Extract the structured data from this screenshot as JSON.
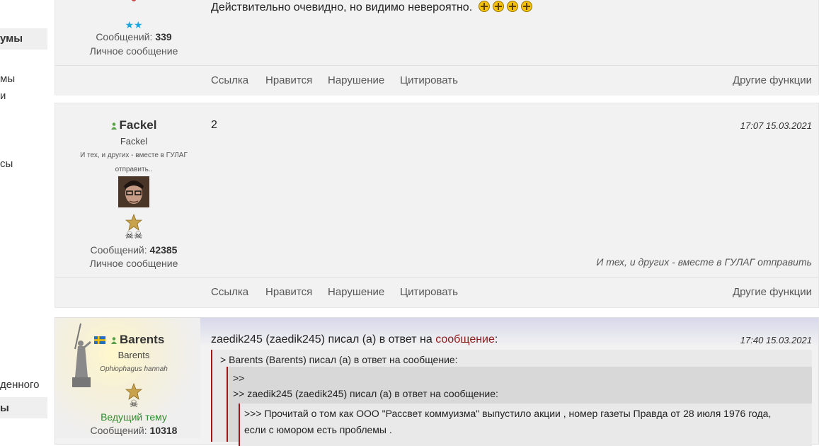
{
  "sidebar": {
    "items": [
      {
        "label": "умы",
        "bold": true
      },
      {
        "label": "мы",
        "bold": false
      },
      {
        "label": "и",
        "bold": false
      },
      {
        "label": "сы",
        "bold": false
      },
      {
        "label": "денного",
        "bold": false
      },
      {
        "label": "ы",
        "bold": true
      }
    ]
  },
  "post1": {
    "stat_label": "Сообщений:",
    "stat_count": "339",
    "pm_label": "Личное сообщение",
    "message": "Действительно очевидно, но видимо невероятно.",
    "smiley_icon": "rofl-smiley-icon",
    "footer": {
      "link": "Ссылка",
      "like": "Нравится",
      "report": "Нарушение",
      "quote": "Цитировать",
      "more": "Другие функции"
    }
  },
  "post2": {
    "name": "Fackel",
    "login": "Fackel",
    "signature_small_1": "И тех, и других - вместе в ГУЛАГ",
    "signature_small_2": "отправить..",
    "stat_label": "Сообщений:",
    "stat_count": "42385",
    "pm_label": "Личное сообщение",
    "message": "2",
    "date": "17:07 15.03.2021",
    "signature": "И тех, и других - вместе в ГУЛАГ отправить",
    "footer": {
      "link": "Ссылка",
      "like": "Нравится",
      "report": "Нарушение",
      "quote": "Цитировать",
      "more": "Другие функции"
    }
  },
  "post3": {
    "name": "Barents",
    "login": "Barents",
    "subtitle": "Ophiophagus hannah",
    "role": "Ведущий тему",
    "stat_label": "Сообщений:",
    "stat_count": "10318",
    "header_prefix": "zaedik245 (zaedik245) писал (а) в ответ на",
    "header_link": "сообщение",
    "header_suffix": ":",
    "date": "17:40 15.03.2021",
    "quotes": {
      "q1": "> Barents (Barents) писал (а) в ответ на сообщение:",
      "q2a": ">>",
      "q2b": ">> zaedik245 (zaedik245) писал (а) в ответ на сообщение:",
      "q3a": ">>> Прочитай о том как ООО \"Рассвет коммуизма\" выпустило акции , номер газеты Правда от 28 июля 1976 года,",
      "q3b": "если с юмором есть проблемы ."
    }
  },
  "colors": {
    "accent": "#8b1c1c",
    "online": "#5aa04a",
    "star_blue": "#1aa7e0",
    "role_green": "#2e8b2e"
  }
}
